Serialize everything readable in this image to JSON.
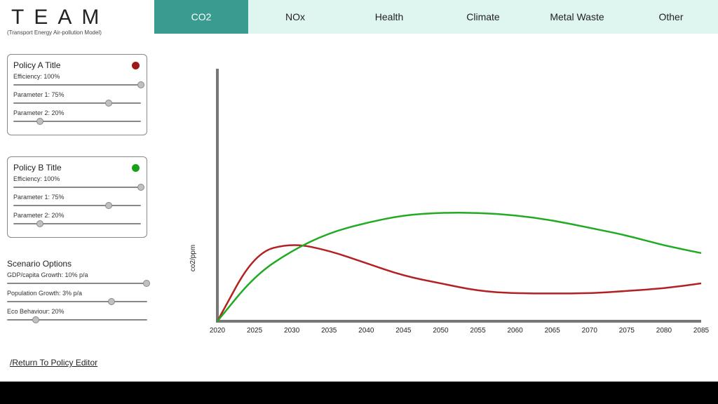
{
  "app": {
    "title": "TEAM",
    "subtitle": "(Transport Energy Air-pollution Model)"
  },
  "policy_a": {
    "title": "Policy A Title",
    "color": "#a01818",
    "efficiency_label": "Efficiency: 100%",
    "efficiency_pos": 97,
    "param1_label": "Parameter 1: 75%",
    "param1_pos": 72,
    "param2_label": "Parameter 2: 20%",
    "param2_pos": 18
  },
  "policy_b": {
    "title": "Policy B Title",
    "color": "#18a018",
    "efficiency_label": "Efficiency: 100%",
    "efficiency_pos": 97,
    "param1_label": "Parameter 1: 75%",
    "param1_pos": 72,
    "param2_label": "Parameter 2: 20%",
    "param2_pos": 18
  },
  "scenario": {
    "title": "Scenario Options",
    "gdp_label": "GDP/capita Growth: 10% p/a",
    "gdp_pos": 97,
    "pop_label": "Population Growth: 3% p/a",
    "pop_pos": 72,
    "eco_label": "Eco Behaviour: 20%",
    "eco_pos": 18
  },
  "return_link": "/Return To Policy Editor",
  "tabs": [
    "CO2",
    "NOx",
    "Health",
    "Climate",
    "Metal Waste",
    "Other"
  ],
  "active_tab": 0,
  "chart_data": {
    "type": "line",
    "ylabel": "co2/ppm",
    "x_ticks": [
      2020,
      2025,
      2030,
      2035,
      2040,
      2045,
      2050,
      2055,
      2060,
      2065,
      2070,
      2075,
      2080,
      2085
    ],
    "x_range": [
      2020,
      2085
    ],
    "series": [
      {
        "name": "Policy A",
        "color": "#b22222",
        "x": [
          2020,
          2025,
          2030,
          2035,
          2040,
          2045,
          2050,
          2055,
          2060,
          2065,
          2070,
          2075,
          2080,
          2085
        ],
        "y": [
          0.0,
          0.27,
          0.31,
          0.28,
          0.23,
          0.18,
          0.15,
          0.12,
          0.11,
          0.11,
          0.11,
          0.12,
          0.13,
          0.15
        ]
      },
      {
        "name": "Policy B",
        "color": "#22aa22",
        "x": [
          2020,
          2025,
          2030,
          2035,
          2040,
          2045,
          2050,
          2055,
          2060,
          2065,
          2070,
          2075,
          2080,
          2085
        ],
        "y": [
          0.0,
          0.18,
          0.28,
          0.35,
          0.39,
          0.42,
          0.43,
          0.43,
          0.42,
          0.4,
          0.37,
          0.34,
          0.3,
          0.27
        ]
      }
    ],
    "y_range": [
      0,
      1
    ]
  }
}
